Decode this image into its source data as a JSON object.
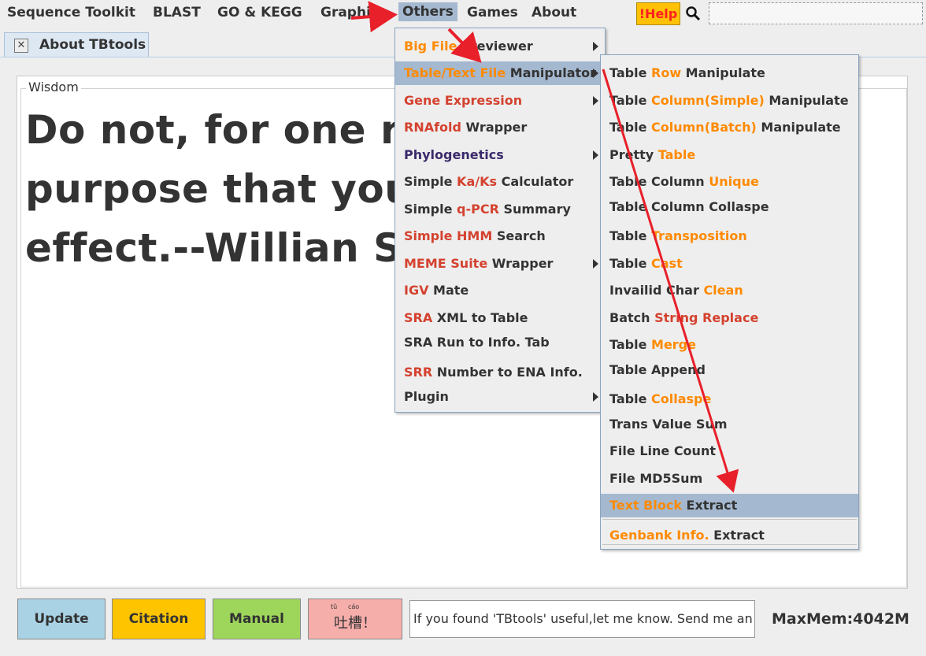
{
  "menubar": {
    "items": [
      "Sequence Toolkit",
      "BLAST",
      "GO & KEGG",
      "Graphics",
      "Others",
      "Games",
      "About"
    ],
    "help_label": "!Help",
    "search_value": ""
  },
  "tab": {
    "label": "About TBtools",
    "close_glyph": "✕"
  },
  "wisdom": {
    "label": "Wisdom",
    "lines": [
      "Do not, for one rep",
      "purpose that you r",
      "effect.--Willian Sha"
    ]
  },
  "others_menu": {
    "items": [
      {
        "parts": [
          [
            "Big File",
            "o"
          ],
          [
            " Previewer",
            "d"
          ]
        ],
        "submenu": true
      },
      {
        "parts": [
          [
            "Table/Text File",
            "o"
          ],
          [
            " Manipulator",
            "d"
          ]
        ],
        "submenu": true,
        "highlighted": true
      },
      {
        "parts": [
          [
            "Gene Expression",
            "r"
          ]
        ],
        "submenu": true
      },
      {
        "parts": [
          [
            "RNAfold",
            "r"
          ],
          [
            " Wrapper",
            "d"
          ]
        ],
        "submenu": false
      },
      {
        "parts": [
          [
            "Phylogenetics",
            "p"
          ]
        ],
        "submenu": true
      },
      {
        "parts": [
          [
            "Simple ",
            "d"
          ],
          [
            "Ka/Ks",
            "r"
          ],
          [
            " Calculator",
            "d"
          ]
        ],
        "submenu": false
      },
      {
        "parts": [
          [
            "Simple ",
            "d"
          ],
          [
            "q-PCR",
            "r"
          ],
          [
            " Summary",
            "d"
          ]
        ],
        "submenu": false
      },
      {
        "parts": [
          [
            "Simple HMM",
            "r"
          ],
          [
            " Search",
            "d"
          ]
        ],
        "submenu": false
      },
      {
        "parts": [
          [
            "MEME Suite",
            "r"
          ],
          [
            " Wrapper",
            "d"
          ]
        ],
        "submenu": true
      },
      {
        "parts": [
          [
            "IGV",
            "r"
          ],
          [
            " Mate",
            "d"
          ]
        ],
        "submenu": false
      },
      {
        "parts": [
          [
            "SRA",
            "r"
          ],
          [
            " XML to Table",
            "d"
          ]
        ],
        "submenu": false
      },
      {
        "parts": [
          [
            "SRA Run to Info. Tab",
            "d"
          ]
        ],
        "submenu": false
      },
      {
        "parts": [
          [
            "SRR",
            "r"
          ],
          [
            " Number to ENA Info.",
            "d"
          ]
        ],
        "submenu": false
      },
      {
        "parts": [
          [
            "Plugin",
            "d"
          ]
        ],
        "submenu": true
      }
    ]
  },
  "table_menu": {
    "items": [
      {
        "parts": [
          [
            "Table ",
            "d"
          ],
          [
            "Row",
            "o"
          ],
          [
            " Manipulate",
            "d"
          ]
        ]
      },
      {
        "parts": [
          [
            "Table ",
            "d"
          ],
          [
            "Column(Simple)",
            "o"
          ],
          [
            " Manipulate",
            "d"
          ]
        ]
      },
      {
        "parts": [
          [
            "Table ",
            "d"
          ],
          [
            "Column(Batch)",
            "o"
          ],
          [
            " Manipulate",
            "d"
          ]
        ]
      },
      {
        "parts": [
          [
            "Pretty ",
            "d"
          ],
          [
            "Table",
            "o"
          ]
        ]
      },
      {
        "parts": [
          [
            "Table Column ",
            "d"
          ],
          [
            "Unique",
            "o"
          ]
        ]
      },
      {
        "parts": [
          [
            "Table Column Collaspe",
            "d"
          ]
        ]
      },
      {
        "parts": [
          [
            "Table ",
            "d"
          ],
          [
            "Transposition",
            "o"
          ]
        ]
      },
      {
        "parts": [
          [
            "Table ",
            "d"
          ],
          [
            "Cast",
            "o"
          ]
        ]
      },
      {
        "parts": [
          [
            "Invailid Char ",
            "d"
          ],
          [
            "Clean",
            "o"
          ]
        ]
      },
      {
        "parts": [
          [
            "Batch ",
            "d"
          ],
          [
            "String Replace",
            "r"
          ]
        ]
      },
      {
        "parts": [
          [
            "Table ",
            "d"
          ],
          [
            "Merge",
            "o"
          ]
        ]
      },
      {
        "parts": [
          [
            "Table Append",
            "d"
          ]
        ]
      },
      {
        "parts": [
          [
            "Table ",
            "d"
          ],
          [
            "Collaspe",
            "o"
          ]
        ]
      },
      {
        "parts": [
          [
            "Trans Value Sum",
            "d"
          ]
        ]
      },
      {
        "parts": [
          [
            "File Line Count",
            "d"
          ]
        ]
      },
      {
        "parts": [
          [
            "File MD5Sum",
            "d"
          ]
        ]
      },
      {
        "parts": [
          [
            "Text Block",
            "o"
          ],
          [
            " Extract",
            "d"
          ]
        ],
        "highlighted": true
      },
      {
        "parts": [
          [
            "Genbank Info.",
            "o"
          ],
          [
            " Extract",
            "d"
          ]
        ]
      }
    ]
  },
  "buttons": {
    "update": "Update",
    "citation": "Citation",
    "manual": "Manual",
    "tucao_pinyin": [
      "tǔ",
      "cáo"
    ],
    "tucao": "吐槽！"
  },
  "message": "If you found 'TBtools' useful,let me know. Send me an e",
  "maxmem": "MaxMem:4042M",
  "colors": {
    "highlight": "#a4b8cf",
    "orange": "#ff8a00",
    "red": "#d4422f",
    "purple": "#3b2a6b",
    "arrow": "#e8202a"
  },
  "icons": [
    "search-icon",
    "close-icon",
    "submenu-arrow-icon",
    "annotation-arrow"
  ]
}
